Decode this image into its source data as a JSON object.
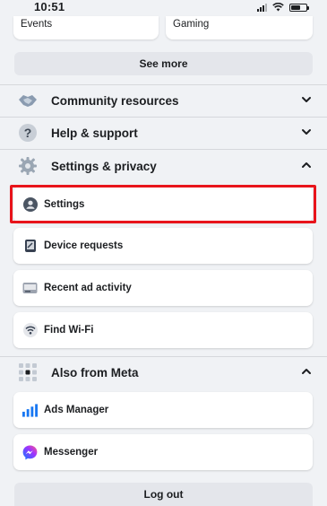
{
  "status_bar": {
    "time": "10:51"
  },
  "shortcuts": [
    {
      "label": "Events"
    },
    {
      "label": "Gaming"
    }
  ],
  "see_more_label": "See more",
  "sections": {
    "community": {
      "label": "Community resources",
      "icon": "handshake-icon",
      "expanded": false
    },
    "help": {
      "label": "Help & support",
      "icon": "question-icon",
      "expanded": false
    },
    "settings_privacy": {
      "label": "Settings & privacy",
      "icon": "gear-icon",
      "expanded": true,
      "items": [
        {
          "label": "Settings",
          "icon": "profile-icon",
          "highlighted": true
        },
        {
          "label": "Device requests",
          "icon": "device-icon"
        },
        {
          "label": "Recent ad activity",
          "icon": "ad-activity-icon"
        },
        {
          "label": "Find Wi-Fi",
          "icon": "wifi-icon"
        }
      ]
    },
    "meta": {
      "label": "Also from Meta",
      "icon": "grid-icon",
      "expanded": true,
      "items": [
        {
          "label": "Ads Manager",
          "icon": "ads-manager-icon"
        },
        {
          "label": "Messenger",
          "icon": "messenger-icon"
        }
      ]
    }
  },
  "logout_label": "Log out",
  "colors": {
    "background": "#f0f2f5",
    "highlight": "#e8141b",
    "facebook_blue": "#1877f2",
    "messenger_purple": "#a033ff"
  }
}
